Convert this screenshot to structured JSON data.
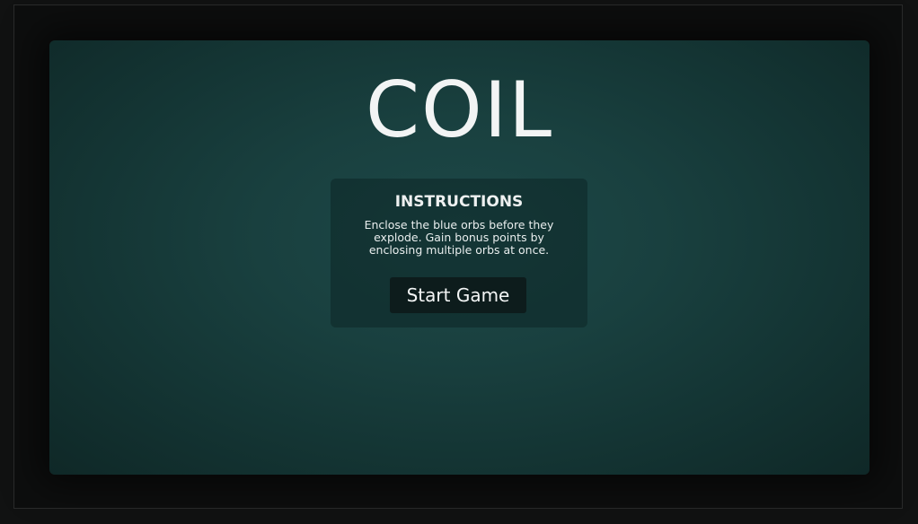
{
  "game": {
    "title": "COIL"
  },
  "instructions": {
    "heading": "INSTRUCTIONS",
    "text": "Enclose the blue orbs before they explode. Gain bonus points by enclosing multiple orbs at once."
  },
  "start_button": {
    "label": "Start Game"
  },
  "colors": {
    "page_background": "#111212",
    "canvas_center": "#1d4848",
    "canvas_edge": "#0f2827",
    "button_background": "#0d1c1c",
    "text": "#f2f4f4"
  }
}
